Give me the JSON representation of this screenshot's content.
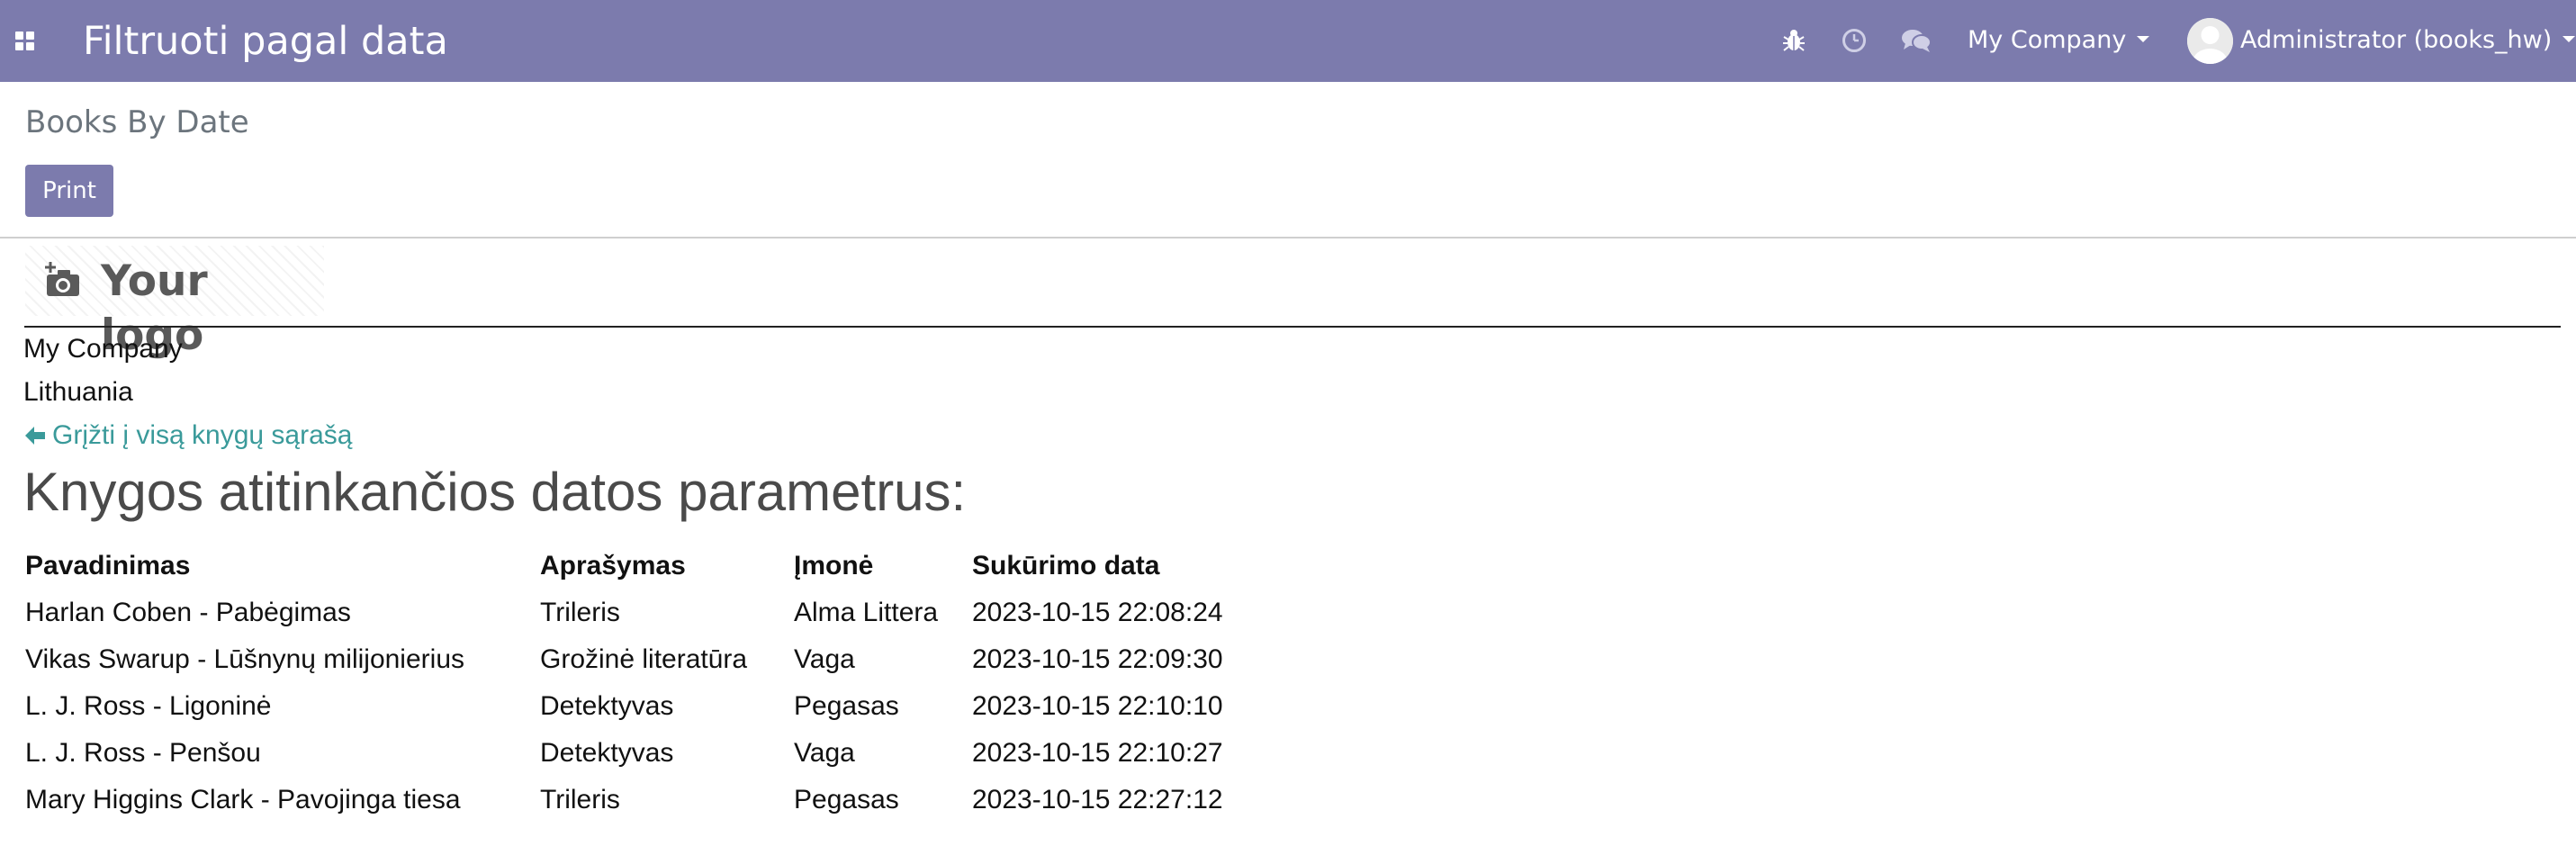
{
  "navbar": {
    "app_title": "Filtruoti pagal data",
    "company_label": "My Company",
    "user_label": "Administrator (books_hw)",
    "accent_color": "#7c7bad"
  },
  "control_panel": {
    "title": "Books By Date",
    "print_label": "Print"
  },
  "report": {
    "logo_text": "Your logo",
    "company_name": "My Company",
    "country": "Lithuania",
    "back_link": "Grįžti į visą knygų sąrašą",
    "heading": "Knygos atitinkančios datos parametrus:",
    "table": {
      "headers": [
        "Pavadinimas",
        "Aprašymas",
        "Įmonė",
        "Sukūrimo data"
      ],
      "rows": [
        [
          "Harlan Coben - Pabėgimas",
          "Trileris",
          "Alma Littera",
          "2023-10-15 22:08:24"
        ],
        [
          "Vikas Swarup - Lūšnynų milijonierius",
          "Grožinė literatūra",
          "Vaga",
          "2023-10-15 22:09:30"
        ],
        [
          "L. J. Ross - Ligoninė",
          "Detektyvas",
          "Pegasas",
          "2023-10-15 22:10:10"
        ],
        [
          "L. J. Ross - Penšou",
          "Detektyvas",
          "Vaga",
          "2023-10-15 22:10:27"
        ],
        [
          "Mary Higgins Clark - Pavojinga tiesa",
          "Trileris",
          "Pegasas",
          "2023-10-15 22:27:12"
        ]
      ]
    }
  }
}
